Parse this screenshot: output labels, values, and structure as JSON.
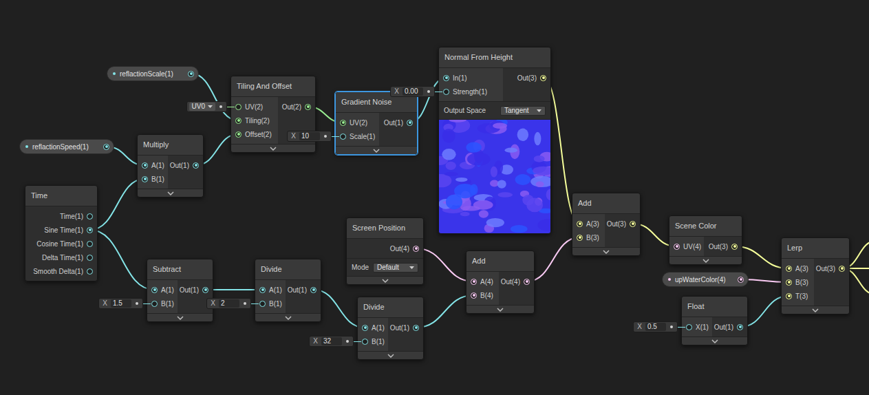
{
  "graph": {
    "properties": [
      {
        "name": "reflactionScale(1)",
        "color": "#84e4e7"
      },
      {
        "name": "reflactionSpeed(1)",
        "color": "#84e4e7"
      },
      {
        "name": "upWaterColor(4)",
        "color": "#fbcbf4"
      }
    ],
    "nodes": [
      {
        "title": "Time",
        "selected": false,
        "inputs": [],
        "outputs": [
          {
            "label": "Time(1)",
            "color": "#84e4e7",
            "connected": false
          },
          {
            "label": "Sine Time(1)",
            "color": "#84e4e7",
            "connected": true
          },
          {
            "label": "Cosine Time(1)",
            "color": "#84e4e7",
            "connected": false
          },
          {
            "label": "Delta Time(1)",
            "color": "#84e4e7",
            "connected": false
          },
          {
            "label": "Smooth Delta(1)",
            "color": "#84e4e7",
            "connected": false
          }
        ],
        "settings": [],
        "preview": false
      },
      {
        "title": "Multiply",
        "selected": false,
        "inputs": [
          {
            "label": "A(1)",
            "color": "#84e4e7",
            "connected": true
          },
          {
            "label": "B(1)",
            "color": "#84e4e7",
            "connected": true
          }
        ],
        "outputs": [
          {
            "label": "Out(1)",
            "color": "#84e4e7",
            "connected": true
          }
        ],
        "settings": [],
        "preview": false
      },
      {
        "title": "Tiling And Offset",
        "selected": false,
        "inputs": [
          {
            "label": "UV(2)",
            "color": "#9aef92",
            "connected": false,
            "field": {
              "kind": "dropdown",
              "value": "UV0"
            }
          },
          {
            "label": "Tiling(2)",
            "color": "#9aef92",
            "connected": true
          },
          {
            "label": "Offset(2)",
            "color": "#9aef92",
            "connected": true
          }
        ],
        "outputs": [
          {
            "label": "Out(2)",
            "color": "#9aef92",
            "connected": true
          }
        ],
        "settings": [],
        "preview": false
      },
      {
        "title": "Gradient Noise",
        "selected": true,
        "inputs": [
          {
            "label": "UV(2)",
            "color": "#9aef92",
            "connected": true
          },
          {
            "label": "Scale(1)",
            "color": "#84e4e7",
            "connected": false,
            "field": {
              "kind": "number",
              "label": "X",
              "value": "10"
            }
          }
        ],
        "outputs": [
          {
            "label": "Out(1)",
            "color": "#84e4e7",
            "connected": true
          }
        ],
        "settings": [],
        "preview": false
      },
      {
        "title": "Normal From Height",
        "selected": false,
        "inputs": [
          {
            "label": "In(1)",
            "color": "#84e4e7",
            "connected": true
          },
          {
            "label": "Strength(1)",
            "color": "#84e4e7",
            "connected": false,
            "field": {
              "kind": "number",
              "label": "X",
              "value": "0.00"
            }
          }
        ],
        "outputs": [
          {
            "label": "Out(3)",
            "color": "#f6ff9a",
            "connected": true
          }
        ],
        "settings": [
          {
            "label": "Output Space",
            "value": "Tangent"
          }
        ],
        "preview": true
      },
      {
        "title": "Screen Position",
        "selected": false,
        "inputs": [],
        "outputs": [
          {
            "label": "Out(4)",
            "color": "#fbcbf4",
            "connected": true
          }
        ],
        "settings": [
          {
            "label": "Mode",
            "value": "Default"
          }
        ],
        "preview": false
      },
      {
        "title": "Subtract",
        "selected": false,
        "inputs": [
          {
            "label": "A(1)",
            "color": "#84e4e7",
            "connected": true
          },
          {
            "label": "B(1)",
            "color": "#84e4e7",
            "connected": false,
            "field": {
              "kind": "number",
              "label": "X",
              "value": "1.5"
            }
          }
        ],
        "outputs": [
          {
            "label": "Out(1)",
            "color": "#84e4e7",
            "connected": true
          }
        ],
        "settings": [],
        "preview": false
      },
      {
        "title": "Divide",
        "selected": false,
        "inputs": [
          {
            "label": "A(1)",
            "color": "#84e4e7",
            "connected": true
          },
          {
            "label": "B(1)",
            "color": "#84e4e7",
            "connected": false,
            "field": {
              "kind": "number",
              "label": "X",
              "value": "2"
            }
          }
        ],
        "outputs": [
          {
            "label": "Out(1)",
            "color": "#84e4e7",
            "connected": true
          }
        ],
        "settings": [],
        "preview": false
      },
      {
        "title": "Divide",
        "selected": false,
        "inputs": [
          {
            "label": "A(1)",
            "color": "#84e4e7",
            "connected": true
          },
          {
            "label": "B(1)",
            "color": "#84e4e7",
            "connected": false,
            "field": {
              "kind": "number",
              "label": "X",
              "value": "32"
            }
          }
        ],
        "outputs": [
          {
            "label": "Out(1)",
            "color": "#84e4e7",
            "connected": true
          }
        ],
        "settings": [],
        "preview": false
      },
      {
        "title": "Add",
        "selected": false,
        "inputs": [
          {
            "label": "A(4)",
            "color": "#fbcbf4",
            "connected": true
          },
          {
            "label": "B(4)",
            "color": "#fbcbf4",
            "connected": true
          }
        ],
        "outputs": [
          {
            "label": "Out(4)",
            "color": "#fbcbf4",
            "connected": true
          }
        ],
        "settings": [],
        "preview": false
      },
      {
        "title": "Add",
        "selected": false,
        "inputs": [
          {
            "label": "A(3)",
            "color": "#f6ff9a",
            "connected": true
          },
          {
            "label": "B(3)",
            "color": "#f6ff9a",
            "connected": true
          }
        ],
        "outputs": [
          {
            "label": "Out(3)",
            "color": "#f6ff9a",
            "connected": true
          }
        ],
        "settings": [],
        "preview": false
      },
      {
        "title": "Scene Color",
        "selected": false,
        "inputs": [
          {
            "label": "UV(4)",
            "color": "#fbcbf4",
            "connected": true
          }
        ],
        "outputs": [
          {
            "label": "Out(3)",
            "color": "#f6ff9a",
            "connected": true
          }
        ],
        "settings": [],
        "preview": false
      },
      {
        "title": "Float",
        "selected": false,
        "inputs": [
          {
            "label": "X(1)",
            "color": "#84e4e7",
            "connected": false,
            "field": {
              "kind": "number",
              "label": "X",
              "value": "0.5"
            }
          }
        ],
        "outputs": [
          {
            "label": "Out(1)",
            "color": "#84e4e7",
            "connected": true
          }
        ],
        "settings": [],
        "preview": false
      },
      {
        "title": "Lerp",
        "selected": false,
        "inputs": [
          {
            "label": "A(3)",
            "color": "#f6ff9a",
            "connected": true
          },
          {
            "label": "B(3)",
            "color": "#f6ff9a",
            "connected": true
          },
          {
            "label": "T(3)",
            "color": "#f6ff9a",
            "connected": true
          }
        ],
        "outputs": [
          {
            "label": "Out(3)",
            "color": "#f6ff9a",
            "connected": true
          }
        ],
        "settings": [],
        "preview": false
      }
    ]
  }
}
